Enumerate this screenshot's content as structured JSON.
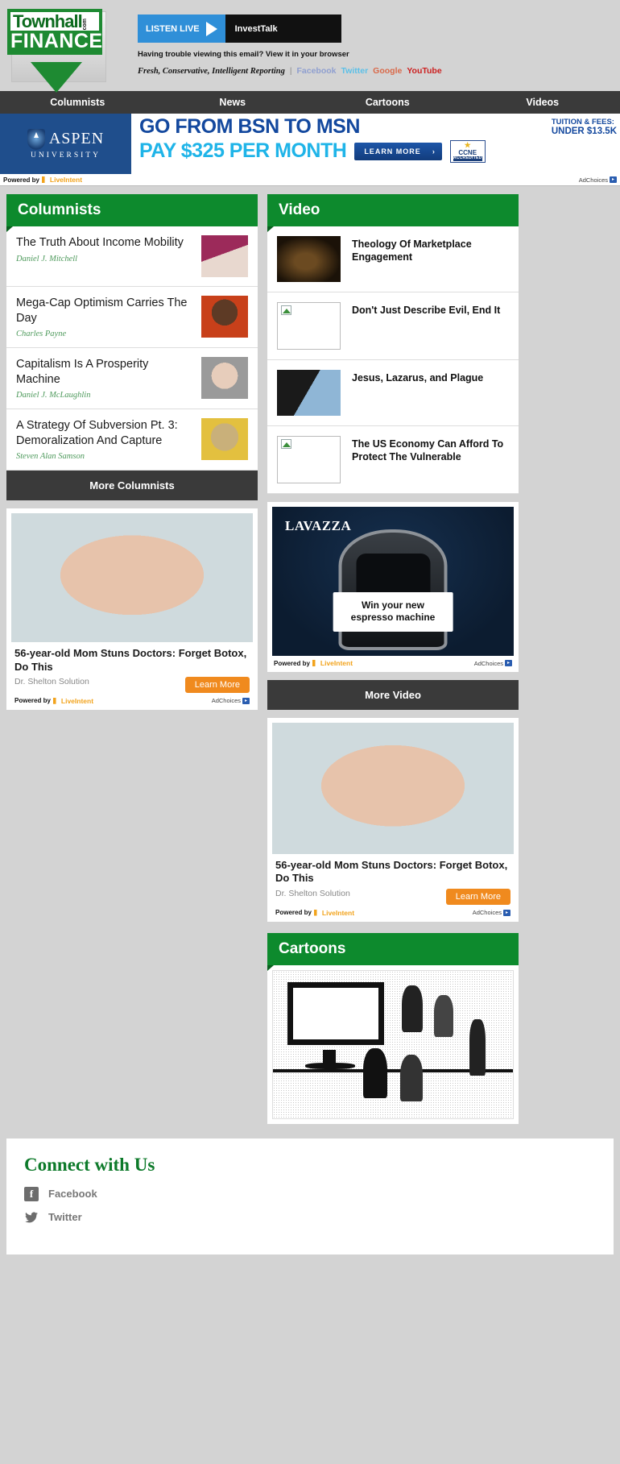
{
  "header": {
    "logo": {
      "brand": "Townhall",
      "com": "com",
      "section": "FINANCE"
    },
    "listen": {
      "label": "LISTEN LIVE",
      "show": "InvestTalk"
    },
    "trouble_text": "Having trouble viewing this email? View it in your browser",
    "tagline": "Fresh, Conservative, Intelligent Reporting",
    "social": [
      {
        "label": "Facebook"
      },
      {
        "label": "Twitter"
      },
      {
        "label": "Google"
      },
      {
        "label": "YouTube"
      }
    ]
  },
  "nav": {
    "items": [
      {
        "label": "Columnists"
      },
      {
        "label": "News"
      },
      {
        "label": "Cartoons"
      },
      {
        "label": "Videos"
      }
    ]
  },
  "banner_ad": {
    "advertiser": "ASPEN",
    "advertiser_sub": "UNIVERSITY",
    "headline": "GO FROM BSN TO MSN",
    "fees_label": "TUITION & FEES:",
    "fees_value": "UNDER $13.5K",
    "price_line": "PAY $325 PER MONTH",
    "cta": "LEARN MORE",
    "cta_arrow": "›",
    "accred_name": "CCNE",
    "accred_sub": "ACCREDITED",
    "powered_by": "Powered by",
    "powered_brand": "LiveIntent",
    "adchoices": "AdChoices"
  },
  "columnists": {
    "title": "Columnists",
    "more_label": "More Columnists",
    "items": [
      {
        "title": "The Truth About Income Mobility",
        "author": "Daniel J. Mitchell"
      },
      {
        "title": "Mega-Cap Optimism Carries The Day",
        "author": "Charles Payne"
      },
      {
        "title": "Capitalism Is A Prosperity Machine",
        "author": "Daniel J. McLaughlin"
      },
      {
        "title": "A Strategy Of Subversion Pt. 3: Demoralization And Capture",
        "author": "Steven Alan Samson"
      }
    ]
  },
  "video": {
    "title": "Video",
    "more_label": "More Video",
    "items": [
      {
        "title": "Theology Of Marketplace Engagement",
        "image_broken": false
      },
      {
        "title": "Don't Just Describe Evil, End It",
        "image_broken": true
      },
      {
        "title": "Jesus, Lazarus, and Plague",
        "image_broken": false
      },
      {
        "title": "The US Economy Can Afford To Protect The Vulnerable",
        "image_broken": true
      }
    ]
  },
  "native_ad": {
    "headline": "56-year-old Mom Stuns Doctors: Forget Botox, Do This",
    "sponsor": "Dr. Shelton Solution",
    "cta": "Learn More",
    "powered_by": "Powered by",
    "powered_brand": "LiveIntent",
    "adchoices": "AdChoices"
  },
  "lavazza_ad": {
    "brand": "LAVAZZA",
    "callout_line1": "Win your new",
    "callout_line2": "espresso machine",
    "powered_by": "Powered by",
    "powered_brand": "LiveIntent",
    "adchoices": "AdChoices"
  },
  "cartoons": {
    "title": "Cartoons"
  },
  "footer": {
    "title": "Connect with Us",
    "links": [
      {
        "label": "Facebook",
        "icon": "facebook-icon",
        "glyph": "f"
      },
      {
        "label": "Twitter",
        "icon": "twitter-icon",
        "glyph": "ᴠ"
      }
    ]
  },
  "colors": {
    "brand_green": "#0d8a2d",
    "nav_dark": "#3a3a3a",
    "page_bg": "#d3d3d3",
    "accent_orange": "#f08a1e",
    "banner_blue": "#13489e"
  }
}
